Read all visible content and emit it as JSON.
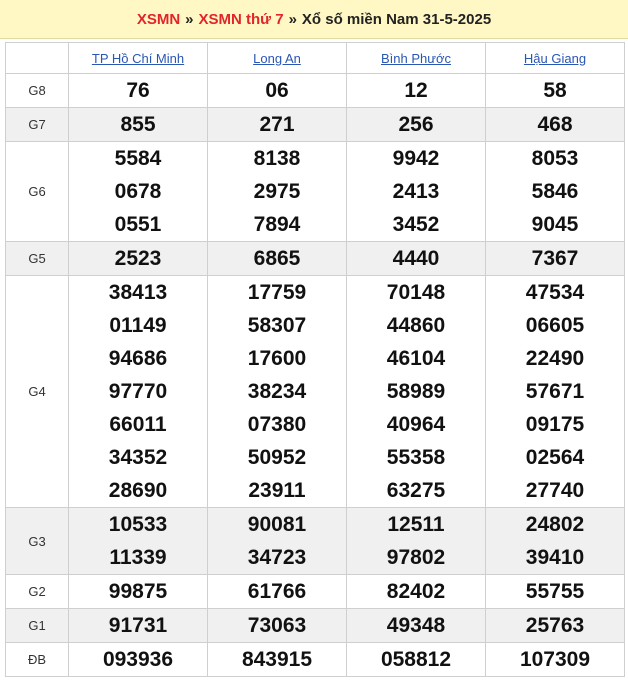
{
  "breadcrumb": {
    "link1": "XSMN",
    "sep1": "»",
    "link2": "XSMN thứ 7",
    "sep2": "»",
    "current": "Xổ số miền Nam 31-5-2025"
  },
  "provinces": [
    "TP Hồ Chí Minh",
    "Long An",
    "Bình Phước",
    "Hậu Giang"
  ],
  "prizes": [
    {
      "label": "G8",
      "values": [
        [
          "76"
        ],
        [
          "06"
        ],
        [
          "12"
        ],
        [
          "58"
        ]
      ]
    },
    {
      "label": "G7",
      "values": [
        [
          "855"
        ],
        [
          "271"
        ],
        [
          "256"
        ],
        [
          "468"
        ]
      ]
    },
    {
      "label": "G6",
      "values": [
        [
          "5584",
          "0678",
          "0551"
        ],
        [
          "8138",
          "2975",
          "7894"
        ],
        [
          "9942",
          "2413",
          "3452"
        ],
        [
          "8053",
          "5846",
          "9045"
        ]
      ]
    },
    {
      "label": "G5",
      "values": [
        [
          "2523"
        ],
        [
          "6865"
        ],
        [
          "4440"
        ],
        [
          "7367"
        ]
      ]
    },
    {
      "label": "G4",
      "values": [
        [
          "38413",
          "01149",
          "94686",
          "97770",
          "66011",
          "34352",
          "28690"
        ],
        [
          "17759",
          "58307",
          "17600",
          "38234",
          "07380",
          "50952",
          "23911"
        ],
        [
          "70148",
          "44860",
          "46104",
          "58989",
          "40964",
          "55358",
          "63275"
        ],
        [
          "47534",
          "06605",
          "22490",
          "57671",
          "09175",
          "02564",
          "27740"
        ]
      ]
    },
    {
      "label": "G3",
      "values": [
        [
          "10533",
          "11339"
        ],
        [
          "90081",
          "34723"
        ],
        [
          "12511",
          "97802"
        ],
        [
          "24802",
          "39410"
        ]
      ]
    },
    {
      "label": "G2",
      "values": [
        [
          "99875"
        ],
        [
          "61766"
        ],
        [
          "82402"
        ],
        [
          "55755"
        ]
      ]
    },
    {
      "label": "G1",
      "values": [
        [
          "91731"
        ],
        [
          "73063"
        ],
        [
          "49348"
        ],
        [
          "25763"
        ]
      ]
    },
    {
      "label": "ĐB",
      "values": [
        [
          "093936"
        ],
        [
          "843915"
        ],
        [
          "058812"
        ],
        [
          "107309"
        ]
      ]
    }
  ]
}
